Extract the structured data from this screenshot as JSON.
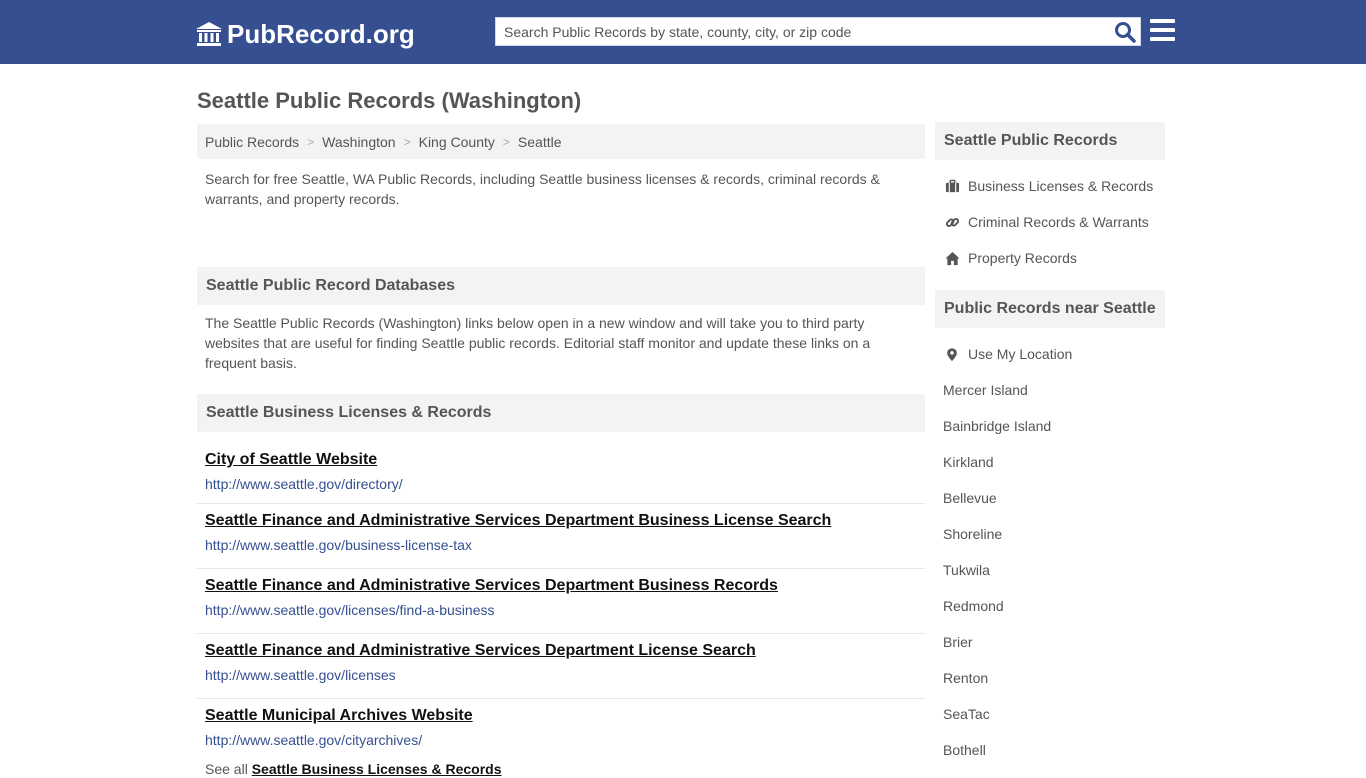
{
  "header": {
    "logo_text": "PubRecord.org",
    "search_placeholder": "Search Public Records by state, county, city, or zip code",
    "colors": {
      "bar": "#354f91",
      "link": "#354f91"
    }
  },
  "page_title": "Seattle Public Records (Washington)",
  "breadcrumb": [
    "Public Records",
    "Washington",
    "King County",
    "Seattle"
  ],
  "intro": "Search for free Seattle, WA Public Records, including Seattle business licenses & records, criminal records & warrants, and property records.",
  "databases": {
    "heading": "Seattle Public Record Databases",
    "text": "The Seattle Public Records (Washington) links below open in a new window and will take you to third party websites that are useful for finding Seattle public records. Editorial staff monitor and update these links on a frequent basis."
  },
  "business": {
    "heading": "Seattle Business Licenses & Records",
    "records": [
      {
        "title": "City of Seattle Website",
        "url": "http://www.seattle.gov/directory/"
      },
      {
        "title": "Seattle Finance and Administrative Services Department Business License Search",
        "url": "http://www.seattle.gov/business-license-tax"
      },
      {
        "title": "Seattle Finance and Administrative Services Department Business Records",
        "url": "http://www.seattle.gov/licenses/find-a-business"
      },
      {
        "title": "Seattle Finance and Administrative Services Department License Search",
        "url": "http://www.seattle.gov/licenses"
      },
      {
        "title": "Seattle Municipal Archives Website",
        "url": "http://www.seattle.gov/cityarchives/"
      }
    ],
    "see_all_prefix": "See all",
    "see_all_link": "Seattle Business Licenses & Records"
  },
  "sidebar": {
    "records_heading": "Seattle Public Records",
    "records_links": [
      {
        "label": "Business Licenses & Records",
        "icon": "briefcase-icon"
      },
      {
        "label": "Criminal Records & Warrants",
        "icon": "link-icon"
      },
      {
        "label": "Property Records",
        "icon": "home-icon"
      }
    ],
    "near_heading": "Public Records near Seattle",
    "use_location": "Use My Location",
    "cities": [
      "Mercer Island",
      "Bainbridge Island",
      "Kirkland",
      "Bellevue",
      "Shoreline",
      "Tukwila",
      "Redmond",
      "Brier",
      "Renton",
      "SeaTac",
      "Bothell"
    ]
  }
}
